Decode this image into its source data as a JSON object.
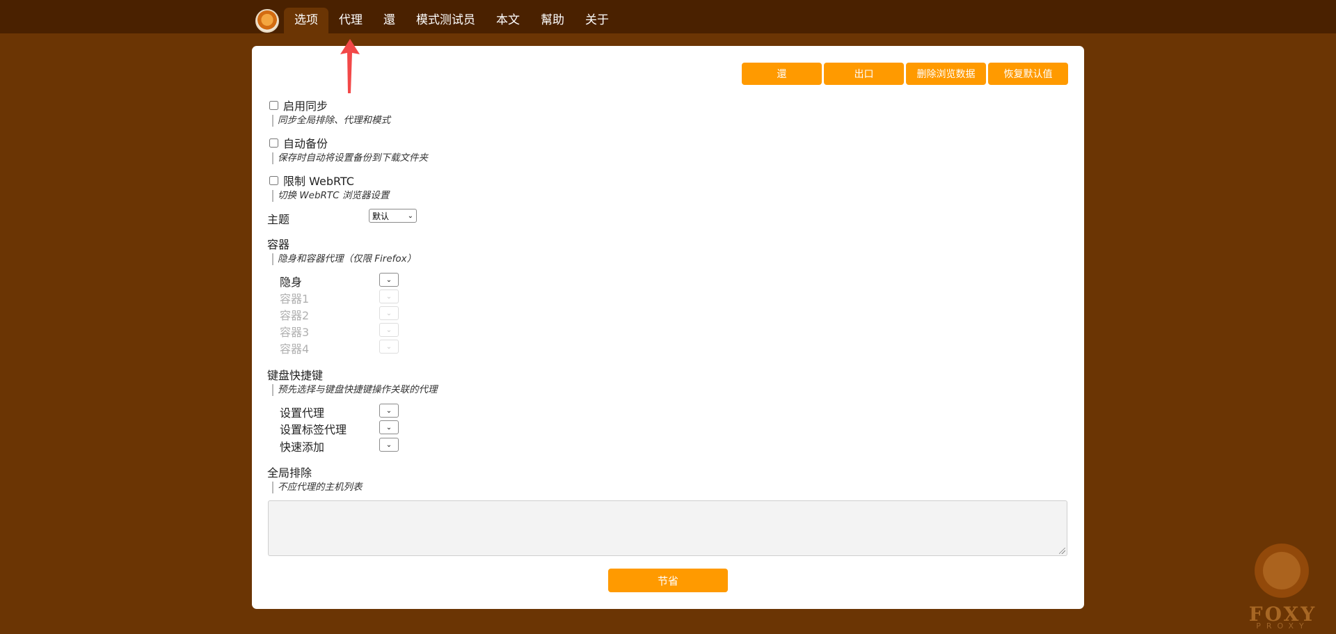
{
  "nav": {
    "items": [
      "选项",
      "代理",
      "還",
      "模式测试员",
      "本文",
      "幫助",
      "关于"
    ],
    "active": "选项"
  },
  "actions": {
    "restore": "還",
    "export": "出口",
    "delete_browsing_data": "删除浏览数据",
    "reset_defaults": "恢复默认值"
  },
  "options": {
    "sync": {
      "label": "启用同步",
      "desc": "同步全局排除、代理和模式",
      "checked": false
    },
    "backup": {
      "label": "自动备份",
      "desc": "保存时自动将设置备份到下载文件夹",
      "checked": false
    },
    "webrtc": {
      "label": "限制 WebRTC",
      "desc": "切换 WebRTC 浏览器设置",
      "checked": false
    }
  },
  "theme": {
    "label": "主题",
    "value": "默认"
  },
  "containers": {
    "label": "容器",
    "desc": "隐身和容器代理（仅限 Firefox）",
    "items": [
      {
        "label": "隐身",
        "enabled": true
      },
      {
        "label": "容器1",
        "enabled": false
      },
      {
        "label": "容器2",
        "enabled": false
      },
      {
        "label": "容器3",
        "enabled": false
      },
      {
        "label": "容器4",
        "enabled": false
      }
    ]
  },
  "shortcuts": {
    "label": "键盘快捷键",
    "desc": "预先选择与键盘快捷键操作关联的代理",
    "items": [
      "设置代理",
      "设置标签代理",
      "快速添加"
    ]
  },
  "global_exclude": {
    "label": "全局排除",
    "desc": "不应代理的主机列表",
    "value": ""
  },
  "save_label": "节省",
  "watermark": {
    "text": "FOXY",
    "sub": "PROXY"
  },
  "colors": {
    "accent": "#ff9a00",
    "background": "#6b3504",
    "topbar": "#4a2100",
    "annotation_arrow": "#f24848"
  }
}
